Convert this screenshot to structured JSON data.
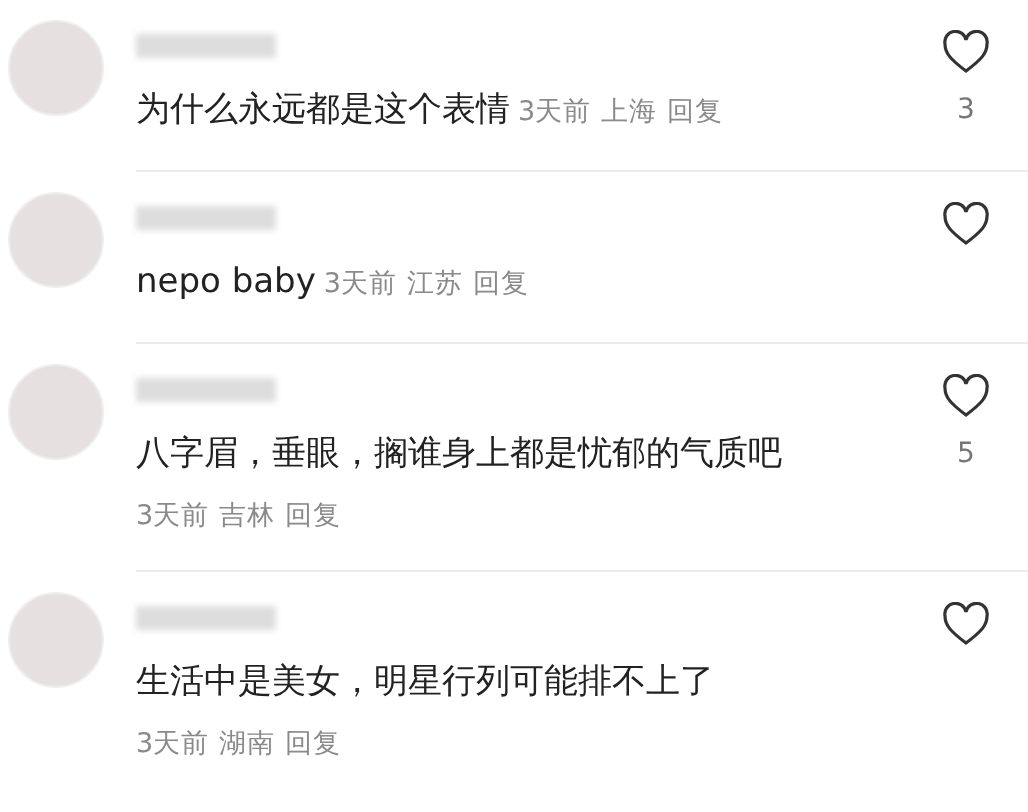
{
  "comments": [
    {
      "kind": "inline",
      "text": "为什么永远都是这个表情",
      "time": "3天前",
      "location": "上海",
      "reply": "回复",
      "liked": false,
      "likes": "3"
    },
    {
      "kind": "inline",
      "text": "nepo baby",
      "time": "3天前",
      "location": "江苏",
      "reply": "回复",
      "liked": false
    },
    {
      "kind": "stacked",
      "text": "八字眉，垂眼，搁谁身上都是忧郁的气质吧",
      "time": "3天前",
      "location": "吉林",
      "reply": "回复",
      "liked": false,
      "likes": "5"
    },
    {
      "kind": "stacked",
      "text": "生活中是美女，明星行列可能排不上了",
      "time": "3天前",
      "location": "湖南",
      "reply": "回复",
      "liked": false
    }
  ]
}
